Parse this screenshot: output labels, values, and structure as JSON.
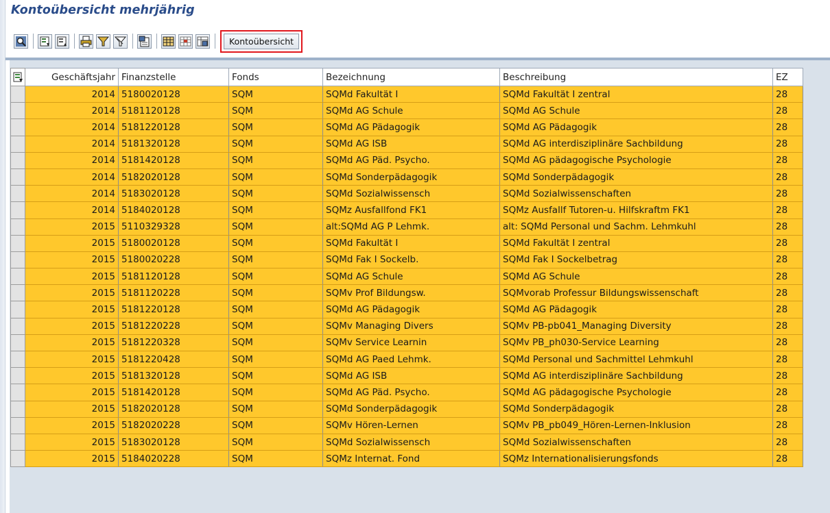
{
  "title": "Kontoübersicht mehrjährig",
  "toolbar": {
    "buttons": [
      {
        "icon": "details-icon"
      },
      {
        "icon": "sort-ascending-icon"
      },
      {
        "icon": "sort-descending-icon"
      },
      {
        "icon": "print-icon"
      },
      {
        "icon": "filter-icon"
      },
      {
        "icon": "filter-delete-icon"
      },
      {
        "icon": "export-icon"
      },
      {
        "icon": "layout-select-icon"
      },
      {
        "icon": "layout-change-icon"
      },
      {
        "icon": "layout-save-icon"
      }
    ],
    "kontouebersicht_label": "Kontoübersicht"
  },
  "grid": {
    "columns": [
      "Geschäftsjahr",
      "Finanzstelle",
      "Fonds",
      "Bezeichnung",
      "Beschreibung",
      "EZ"
    ],
    "rows": [
      [
        "2014",
        "5180020128",
        "SQM",
        "SQMd Fakultät I",
        "SQMd Fakultät I zentral",
        "28"
      ],
      [
        "2014",
        "5181120128",
        "SQM",
        "SQMd AG Schule",
        "SQMd AG Schule",
        "28"
      ],
      [
        "2014",
        "5181220128",
        "SQM",
        "SQMd AG Pädagogik",
        "SQMd AG Pädagogik",
        "28"
      ],
      [
        "2014",
        "5181320128",
        "SQM",
        "SQMd AG ISB",
        "SQMd AG interdisziplinäre Sachbildung",
        "28"
      ],
      [
        "2014",
        "5181420128",
        "SQM",
        "SQMd AG Päd. Psycho.",
        "SQMd AG pädagogische Psychologie",
        "28"
      ],
      [
        "2014",
        "5182020128",
        "SQM",
        "SQMd Sonderpädagogik",
        "SQMd Sonderpädagogik",
        "28"
      ],
      [
        "2014",
        "5183020128",
        "SQM",
        "SQMd Sozialwissensch",
        "SQMd Sozialwissenschaften",
        "28"
      ],
      [
        "2014",
        "5184020128",
        "SQM",
        "SQMz Ausfallfond FK1",
        "SQMz Ausfallf Tutoren-u. Hilfskraftm FK1",
        "28"
      ],
      [
        "2015",
        "5110329328",
        "SQM",
        "alt:SQMd AG P Lehmk.",
        "alt: SQMd Personal und Sachm. Lehmkuhl",
        "28"
      ],
      [
        "2015",
        "5180020128",
        "SQM",
        "SQMd Fakultät I",
        "SQMd Fakultät I zentral",
        "28"
      ],
      [
        "2015",
        "5180020228",
        "SQM",
        "SQMd Fak I Sockelb.",
        "SQMd Fak I Sockelbetrag",
        "28"
      ],
      [
        "2015",
        "5181120128",
        "SQM",
        "SQMd AG Schule",
        "SQMd AG Schule",
        "28"
      ],
      [
        "2015",
        "5181120228",
        "SQM",
        "SQMv Prof Bildungsw.",
        "SQMvorab Professur Bildungswissenschaft",
        "28"
      ],
      [
        "2015",
        "5181220128",
        "SQM",
        "SQMd AG Pädagogik",
        "SQMd AG Pädagogik",
        "28"
      ],
      [
        "2015",
        "5181220228",
        "SQM",
        "SQMv Managing Divers",
        "SQMv PB-pb041_Managing Diversity",
        "28"
      ],
      [
        "2015",
        "5181220328",
        "SQM",
        "SQMv Service Learnin",
        "SQMv PB_ph030-Service Learning",
        "28"
      ],
      [
        "2015",
        "5181220428",
        "SQM",
        "SQMd AG Paed Lehmk.",
        "SQMd Personal und Sachmittel Lehmkuhl",
        "28"
      ],
      [
        "2015",
        "5181320128",
        "SQM",
        "SQMd AG ISB",
        "SQMd AG interdisziplinäre Sachbildung",
        "28"
      ],
      [
        "2015",
        "5181420128",
        "SQM",
        "SQMd AG Päd. Psycho.",
        "SQMd AG pädagogische Psychologie",
        "28"
      ],
      [
        "2015",
        "5182020128",
        "SQM",
        "SQMd Sonderpädagogik",
        "SQMd Sonderpädagogik",
        "28"
      ],
      [
        "2015",
        "5182020228",
        "SQM",
        "SQMv Hören-Lernen",
        "SQMv PB_pb049_Hören-Lernen-Inklusion",
        "28"
      ],
      [
        "2015",
        "5183020128",
        "SQM",
        "SQMd Sozialwissensch",
        "SQMd Sozialwissenschaften",
        "28"
      ],
      [
        "2015",
        "5184020228",
        "SQM",
        "SQMz Internat. Fond",
        "SQMz Internationalisierungsfonds",
        "28"
      ]
    ]
  },
  "colors": {
    "row_background": "#ffc82c",
    "title": "#2a4c8a",
    "highlight_outline": "#e0161c"
  }
}
